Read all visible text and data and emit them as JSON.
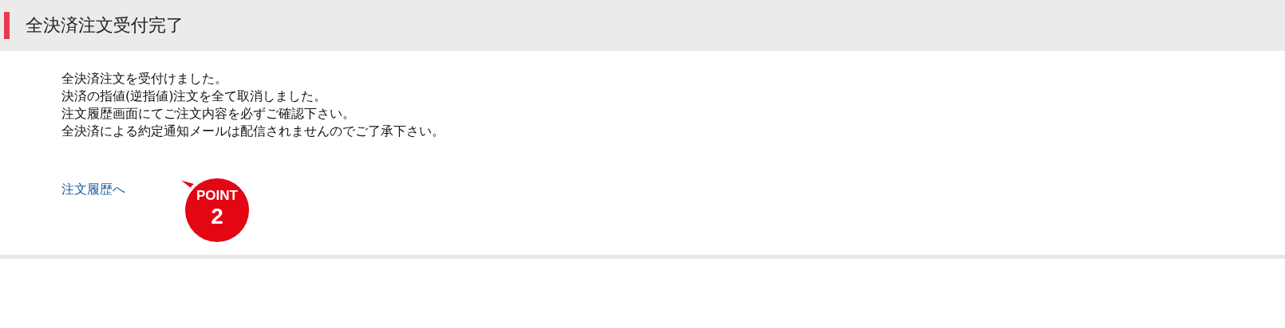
{
  "header": {
    "title": "全決済注文受付完了"
  },
  "messages": [
    "全決済注文を受付けました。",
    "決済の指値(逆指値)注文を全て取消しました。",
    "注文履歴画面にてご注文内容を必ずご確認下さい。",
    "全決済による約定通知メールは配信されませんのでご了承下さい。"
  ],
  "link": {
    "label": "注文履歴へ"
  },
  "badge": {
    "label": "POINT",
    "number": "2"
  }
}
